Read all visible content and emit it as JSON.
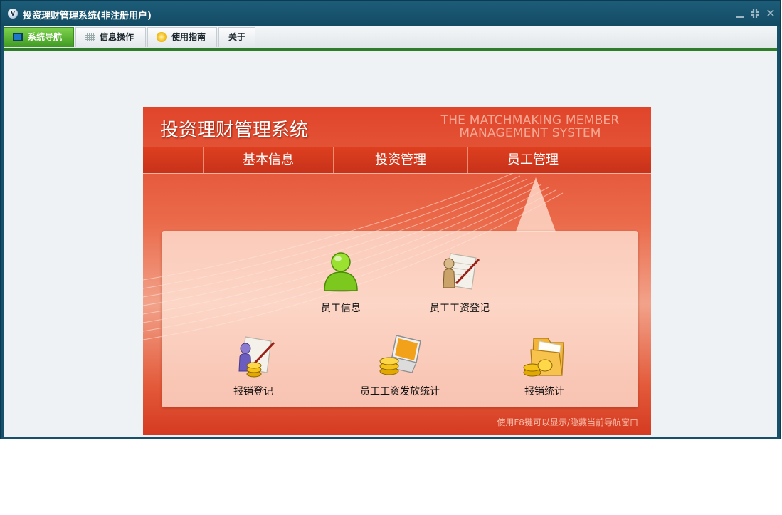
{
  "window": {
    "title": "投资理财管理系统(非注册用户)",
    "icon_letter": "y"
  },
  "menubar": {
    "items": [
      {
        "label": "系统导航",
        "icon": "monitor-icon",
        "active": true
      },
      {
        "label": "信息操作",
        "icon": "grid-icon",
        "active": false
      },
      {
        "label": "使用指南",
        "icon": "compass-icon",
        "active": false
      },
      {
        "label": "关于",
        "icon": "",
        "active": false
      }
    ]
  },
  "panel": {
    "title": "投资理财管理系统",
    "subtitle_line1": "THE MATCHMAKING MEMBER",
    "subtitle_line2": "MANAGEMENT SYSTEM",
    "tabs": [
      {
        "label": "基本信息",
        "active": false
      },
      {
        "label": "投资管理",
        "active": false
      },
      {
        "label": "员工管理",
        "active": true
      }
    ],
    "functions": [
      {
        "label": "员工信息",
        "icon": "person-icon"
      },
      {
        "label": "员工工资登记",
        "icon": "register-icon"
      },
      {
        "label": "报销登记",
        "icon": "expense-register-icon"
      },
      {
        "label": "员工工资发放统计",
        "icon": "laptop-coins-icon"
      },
      {
        "label": "报销统计",
        "icon": "folder-coins-icon"
      }
    ],
    "hint": "使用F8键可以显示/隐藏当前导航窗口"
  },
  "colors": {
    "titlebar": "#134a63",
    "menu_active": "#3f9a22",
    "panel_red": "#e0452a"
  }
}
